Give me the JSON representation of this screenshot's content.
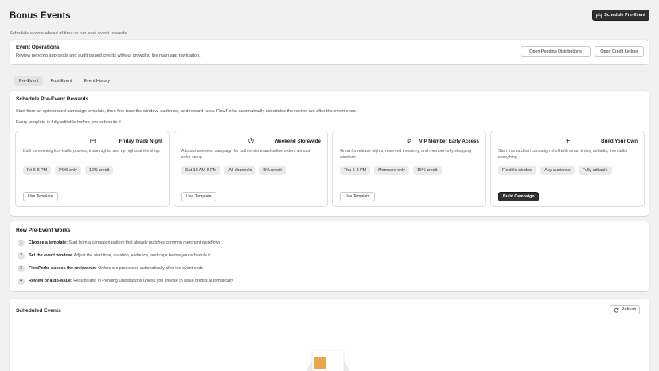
{
  "header": {
    "title": "Bonus Events",
    "subtitle": "Schedule events ahead of time or run post-event rewards",
    "primary_action": "Schedule Pre-Event"
  },
  "operations": {
    "title": "Event Operations",
    "description": "Review pending approvals and audit issued credits without crowding the main app navigation.",
    "btn_pending": "Open Pending Distributions",
    "btn_ledger": "Open Credit Ledger"
  },
  "tabs": [
    {
      "label": "Pre-Event",
      "active": true
    },
    {
      "label": "Post-Event",
      "active": false
    },
    {
      "label": "Event History",
      "active": false
    }
  ],
  "schedule": {
    "title": "Schedule Pre-Event Rewards",
    "line1": "Start from an opinionated campaign template, then fine-tune the window, audience, and reward rules. FlowPerks automatically schedules the review run after the event ends.",
    "line2": "Every template is fully editable before you schedule it."
  },
  "templates": [
    {
      "icon": "calendar-icon",
      "name": "Friday Trade Night",
      "description": "Built for evening foot-traffic pushes, trade nights, and rip nights at the shop.",
      "pills": [
        "Fri 6-9 PM",
        "POS only",
        "10% credit"
      ],
      "action": "Use Template"
    },
    {
      "icon": "clock-icon",
      "name": "Weekend Storewide",
      "description": "A broad weekend campaign for both in-store and online orders without extra setup.",
      "pills": [
        "Sat 10 AM-6 PM",
        "All channels",
        "5% credit"
      ],
      "action": "Use Template"
    },
    {
      "icon": "play-icon",
      "name": "VIP Member Early Access",
      "description": "Great for release nights, reserved inventory, and member-only shopping windows.",
      "pills": [
        "Thu 5-8 PM",
        "Members only",
        "15% credit"
      ],
      "action": "Use Template"
    },
    {
      "icon": "plus-icon",
      "name": "Build Your Own",
      "description": "Start from a clean campaign shell with smart timing defaults, then tailor everything.",
      "pills": [
        "Flexible window",
        "Any audience",
        "Fully editable"
      ],
      "action": "Build Campaign"
    }
  ],
  "how": {
    "title": "How Pre-Event Works",
    "steps": [
      {
        "num": "1",
        "bold": "Choose a template:",
        "text": " Start from a campaign pattern that already matches common merchant workflows"
      },
      {
        "num": "2",
        "bold": "Set the event window:",
        "text": " Adjust the start time, duration, audience, and caps before you schedule it"
      },
      {
        "num": "3",
        "bold": "FlowPerks queues the review run:",
        "text": " Orders are processed automatically after the event ends"
      },
      {
        "num": "4",
        "bold": "Review or auto-issue:",
        "text": " Results land in Pending Distributions unless you choose to issue credits automatically"
      }
    ]
  },
  "scheduled": {
    "title": "Scheduled Events",
    "refresh": "Refresh"
  },
  "colors": {
    "background": "#f1f1f1",
    "primary_button": "#303030",
    "illustration_accent": "#e8a64a"
  }
}
